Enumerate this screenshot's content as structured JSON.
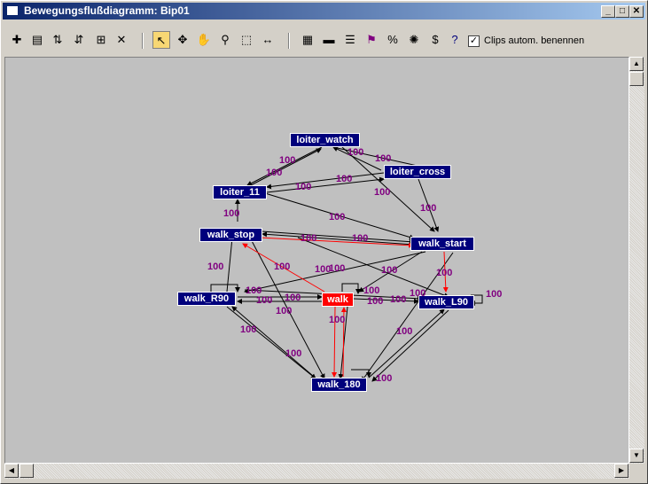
{
  "window": {
    "title": "Bewegungsflußdiagramm: Bip01"
  },
  "toolbar": {
    "checkbox_label": "Clips autom. benennen",
    "checkbox_checked": true,
    "tools": [
      {
        "name": "new-clip-icon",
        "glyph": "✚"
      },
      {
        "name": "open-folder-icon",
        "glyph": "▤"
      },
      {
        "name": "insert-transition-icon",
        "glyph": "⇅"
      },
      {
        "name": "align-transition-icon",
        "glyph": "⇵"
      },
      {
        "name": "grid-icon",
        "glyph": "⊞"
      },
      {
        "name": "delete-icon",
        "glyph": "✕"
      },
      {
        "name": "select-arrow-icon",
        "glyph": "↖"
      },
      {
        "name": "move-icon",
        "glyph": "✥"
      },
      {
        "name": "pan-hand-icon",
        "glyph": "✋"
      },
      {
        "name": "zoom-icon",
        "glyph": "⚲"
      },
      {
        "name": "zoom-region-icon",
        "glyph": "⬚"
      },
      {
        "name": "fit-width-icon",
        "glyph": "↔"
      },
      {
        "name": "layout-icon",
        "glyph": "▦"
      },
      {
        "name": "bar-icon",
        "glyph": "▬"
      },
      {
        "name": "properties-icon",
        "glyph": "☰"
      },
      {
        "name": "flag-icon",
        "glyph": "⚑"
      },
      {
        "name": "percent-icon",
        "glyph": "%"
      },
      {
        "name": "random-icon",
        "glyph": "✺"
      },
      {
        "name": "dollar-icon",
        "glyph": "$"
      },
      {
        "name": "help-icon",
        "glyph": "?"
      }
    ]
  },
  "graph": {
    "nodes": [
      {
        "id": "loiter_watch",
        "label": "loiter_watch"
      },
      {
        "id": "loiter_cross",
        "label": "loiter_cross"
      },
      {
        "id": "loiter_11",
        "label": "loiter_11"
      },
      {
        "id": "walk_stop",
        "label": "walk_stop"
      },
      {
        "id": "walk_start",
        "label": "walk_start"
      },
      {
        "id": "walk_R90",
        "label": "walk_R90"
      },
      {
        "id": "walk",
        "label": "walk",
        "selected": true
      },
      {
        "id": "walk_L90",
        "label": "walk_L90"
      },
      {
        "id": "walk_180",
        "label": "walk_180"
      }
    ],
    "weights": [
      "100",
      "100",
      "100",
      "100",
      "100",
      "100",
      "100",
      "100",
      "100",
      "100",
      "100",
      "100",
      "100",
      "100",
      "100",
      "100",
      "100",
      "100",
      "100",
      "100",
      "100",
      "100",
      "100",
      "100",
      "100",
      "100",
      "100",
      "100",
      "100",
      "100",
      "100",
      "100"
    ],
    "colors": {
      "node": "#00007c",
      "selected": "#ff0000",
      "edge": "#000000",
      "selected_edge": "#ff0000",
      "weight": "#800080",
      "canvas": "#c0c0c0"
    }
  }
}
